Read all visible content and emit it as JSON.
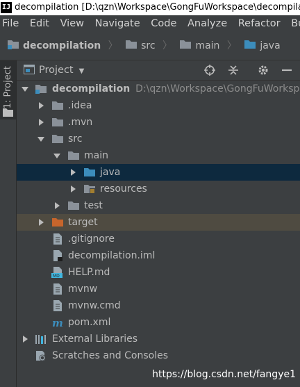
{
  "window": {
    "title": "decompilation [D:\\qzn\\Workspace\\GongFuWorkspace\\decompilation] -",
    "app_icon": "IJ"
  },
  "menu": [
    "File",
    "Edit",
    "View",
    "Navigate",
    "Code",
    "Analyze",
    "Refactor",
    "Build"
  ],
  "breadcrumb": [
    "decompilation",
    "src",
    "main",
    "java"
  ],
  "side_tab": {
    "label": "1: Project"
  },
  "panel": {
    "title": "Project"
  },
  "tree": [
    {
      "label": "decompilation",
      "path": "D:\\qzn\\Workspace\\GongFuWorkspace"
    },
    {
      "label": ".idea"
    },
    {
      "label": ".mvn"
    },
    {
      "label": "src"
    },
    {
      "label": "main"
    },
    {
      "label": "java"
    },
    {
      "label": "resources"
    },
    {
      "label": "test"
    },
    {
      "label": "target"
    },
    {
      "label": ".gitignore"
    },
    {
      "label": "decompilation.iml"
    },
    {
      "label": "HELP.md"
    },
    {
      "label": "mvnw"
    },
    {
      "label": "mvnw.cmd"
    },
    {
      "label": "pom.xml"
    },
    {
      "label": "External Libraries"
    },
    {
      "label": "Scratches and Consoles"
    }
  ],
  "watermark": "https://blog.csdn.net/fangye1",
  "colors": {
    "background": "#3c3f41",
    "selection": "#0d293e",
    "excluded": "#4f4b41",
    "folder": "#8a9199",
    "source_folder": "#3c8dbc",
    "target_folder": "#c7652c"
  }
}
